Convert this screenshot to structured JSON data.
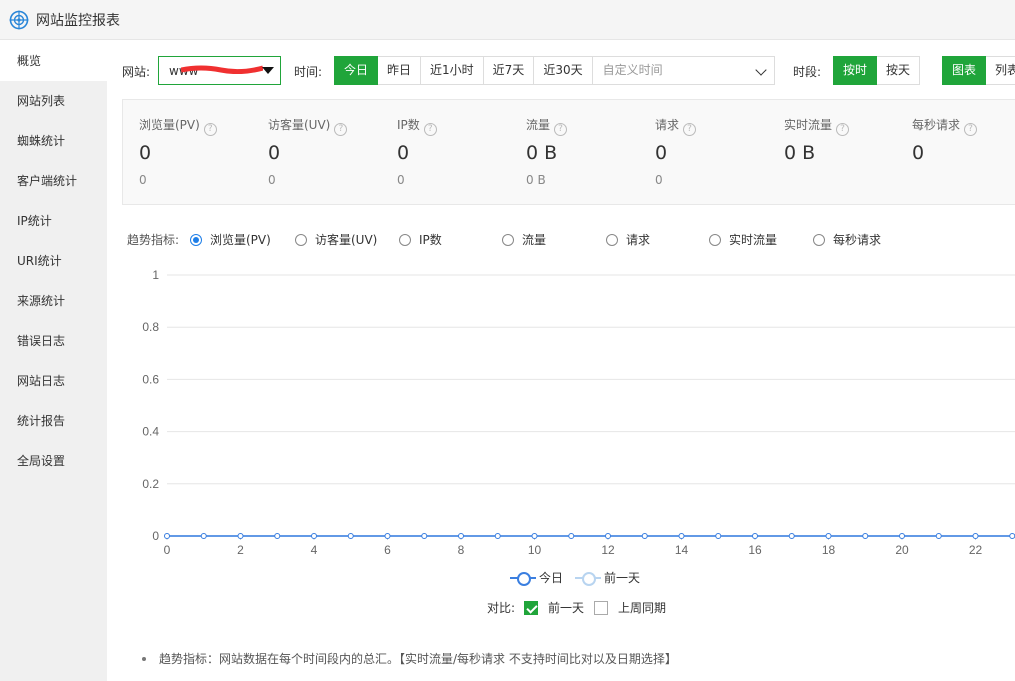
{
  "window": {
    "title": "网站监控报表"
  },
  "sidebar": {
    "items": [
      {
        "label": "概览",
        "active": true
      },
      {
        "label": "网站列表"
      },
      {
        "label": "蜘蛛统计"
      },
      {
        "label": "客户端统计"
      },
      {
        "label": "IP统计"
      },
      {
        "label": "URI统计"
      },
      {
        "label": "来源统计"
      },
      {
        "label": "错误日志"
      },
      {
        "label": "网站日志"
      },
      {
        "label": "统计报告"
      },
      {
        "label": "全局设置"
      }
    ]
  },
  "toolbar": {
    "site_label": "网站:",
    "site_value": "www",
    "time_label": "时间:",
    "time_buttons": [
      "今日",
      "昨日",
      "近1小时",
      "近7天",
      "近30天"
    ],
    "custom_time_placeholder": "自定义时间",
    "period_label": "时段:",
    "period_buttons": [
      "按时",
      "按天"
    ],
    "view_buttons": [
      "图表",
      "列表"
    ]
  },
  "stats": [
    {
      "name": "浏览量(PV)",
      "value": "0",
      "previous": "0"
    },
    {
      "name": "访客量(UV)",
      "value": "0",
      "previous": "0"
    },
    {
      "name": "IP数",
      "value": "0",
      "previous": "0"
    },
    {
      "name": "流量",
      "value": "0 B",
      "previous": "0 B"
    },
    {
      "name": "请求",
      "value": "0",
      "previous": "0"
    },
    {
      "name": "实时流量",
      "value": "0 B",
      "previous": ""
    },
    {
      "name": "每秒请求",
      "value": "0",
      "previous": ""
    }
  ],
  "trend": {
    "label": "趋势指标:",
    "options": [
      "浏览量(PV)",
      "访客量(UV)",
      "IP数",
      "流量",
      "请求",
      "实时流量",
      "每秒请求"
    ],
    "selected": "浏览量(PV)"
  },
  "chart_data": {
    "type": "line",
    "x": [
      0,
      1,
      2,
      3,
      4,
      5,
      6,
      7,
      8,
      9,
      10,
      11,
      12,
      13,
      14,
      15,
      16,
      17,
      18,
      19,
      20,
      21,
      22,
      23
    ],
    "x_tick_labels": [
      "0",
      "2",
      "4",
      "6",
      "8",
      "10",
      "12",
      "14",
      "16",
      "18",
      "20",
      "22"
    ],
    "y_tick_labels": [
      "0",
      "0.2",
      "0.4",
      "0.6",
      "0.8",
      "1"
    ],
    "ylim": [
      0,
      1
    ],
    "grid": true,
    "legend_position": "bottom",
    "series": [
      {
        "name": "今日",
        "color": "#3b7fe0",
        "values": [
          0,
          0,
          0,
          0,
          0,
          0,
          0,
          0,
          0,
          0,
          0,
          0,
          0,
          0,
          0,
          0,
          0,
          0,
          0,
          0,
          0,
          0,
          0,
          0
        ]
      },
      {
        "name": "前一天",
        "color": "#b8d4f0",
        "values": [
          0,
          0,
          0,
          0,
          0,
          0,
          0,
          0,
          0,
          0,
          0,
          0,
          0,
          0,
          0,
          0,
          0,
          0,
          0,
          0,
          0,
          0,
          0,
          0
        ]
      }
    ]
  },
  "compare": {
    "label": "对比:",
    "options": [
      {
        "label": "前一天",
        "checked": true
      },
      {
        "label": "上周同期",
        "checked": false
      }
    ]
  },
  "note": "趋势指标：网站数据在每个时间段内的总汇。【实时流量/每秒请求 不支持时间比对以及日期选择】",
  "colors": {
    "accent": "#20a53a",
    "radio": "#1e7ee8"
  }
}
